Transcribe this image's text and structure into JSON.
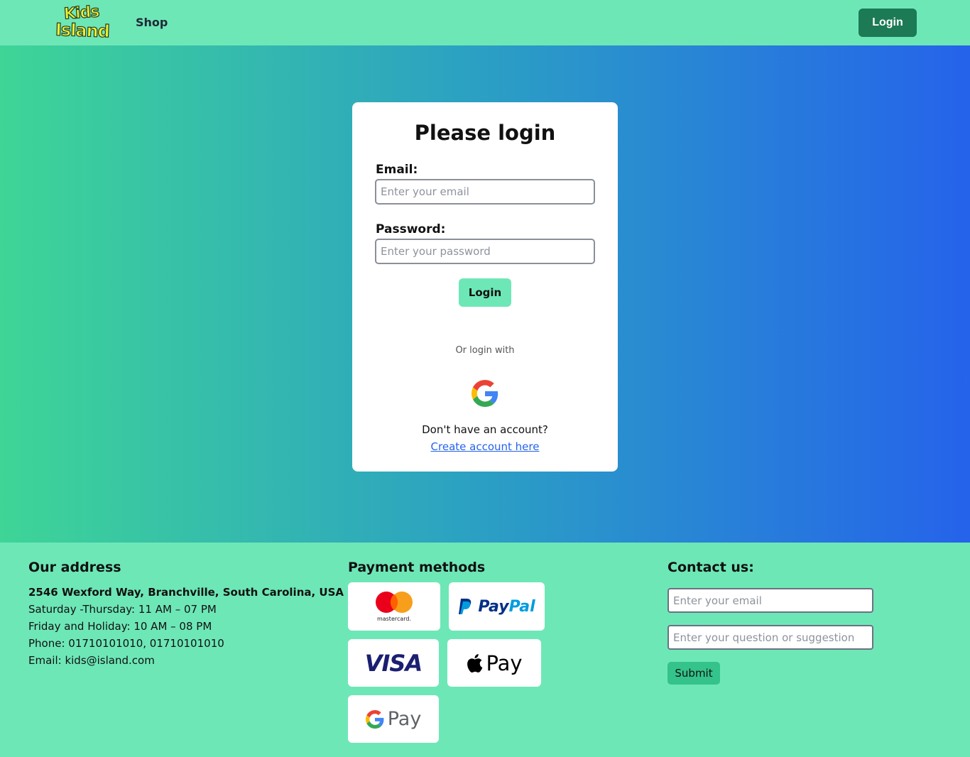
{
  "navbar": {
    "logo_line1": "Kids",
    "logo_line2": "Island",
    "shop_label": "Shop",
    "login_label": "Login"
  },
  "login_card": {
    "title": "Please login",
    "email_label": "Email:",
    "email_placeholder": "Enter your email",
    "password_label": "Password:",
    "password_placeholder": "Enter your password",
    "login_button": "Login",
    "or_text": "Or login with",
    "google_icon": "google-icon",
    "no_account_text": "Don't have an account?",
    "create_account_link": "Create account here"
  },
  "footer": {
    "address": {
      "title": "Our address",
      "line1": "2546 Wexford Way, Branchville, South Carolina, USA",
      "line2": "Saturday -Thursday: 11 AM – 07 PM",
      "line3": "Friday and Holiday: 10 AM – 08 PM",
      "line4": "Phone: 01710101010, 01710101010",
      "line5": "Email: kids@island.com"
    },
    "payment": {
      "title": "Payment methods",
      "mastercard_label": "mastercard.",
      "paypal_label_1": "Pay",
      "paypal_label_2": "Pal",
      "visa_label": "VISA",
      "applepay_label": "Pay",
      "googlepay_label": "Pay"
    },
    "contact": {
      "title": "Contact us:",
      "email_placeholder": "Enter your email",
      "question_placeholder": "Enter your question or suggestion",
      "submit_label": "Submit"
    }
  },
  "colors": {
    "mint": "#6ee7b7",
    "dark_green": "#1c7a55",
    "gradient_start": "#3ed597",
    "gradient_end": "#2563eb",
    "link_blue": "#2563eb"
  }
}
